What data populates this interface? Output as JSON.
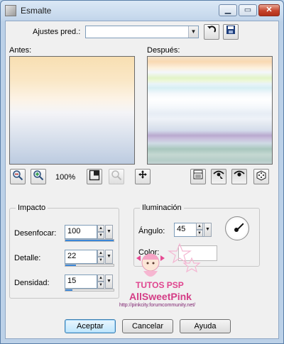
{
  "window": {
    "title": "Esmalte"
  },
  "presets": {
    "label": "Ajustes pred.:",
    "value": ""
  },
  "previews": {
    "before_label": "Antes:",
    "after_label": "Después:"
  },
  "zoom": {
    "level": "100%"
  },
  "impact_group": {
    "title": "Impacto",
    "blur": {
      "label": "Desenfocar:",
      "value": "100",
      "slider_fraction": 1.0
    },
    "detail": {
      "label": "Detalle:",
      "value": "22",
      "slider_fraction": 0.22
    },
    "density": {
      "label": "Densidad:",
      "value": "15",
      "slider_fraction": 0.15
    }
  },
  "lighting_group": {
    "title": "Iluminación",
    "angle": {
      "label": "Ángulo:",
      "value": "45",
      "degrees": 45
    },
    "color": {
      "label": "Color:",
      "value": "#ffffff"
    }
  },
  "buttons": {
    "ok": "Aceptar",
    "cancel": "Cancelar",
    "help": "Ayuda"
  },
  "watermark": {
    "line1": "TUTOS PSP",
    "line2": "AllSweetPink",
    "line3": "http://pinkcity.forumcommunity.net/"
  }
}
